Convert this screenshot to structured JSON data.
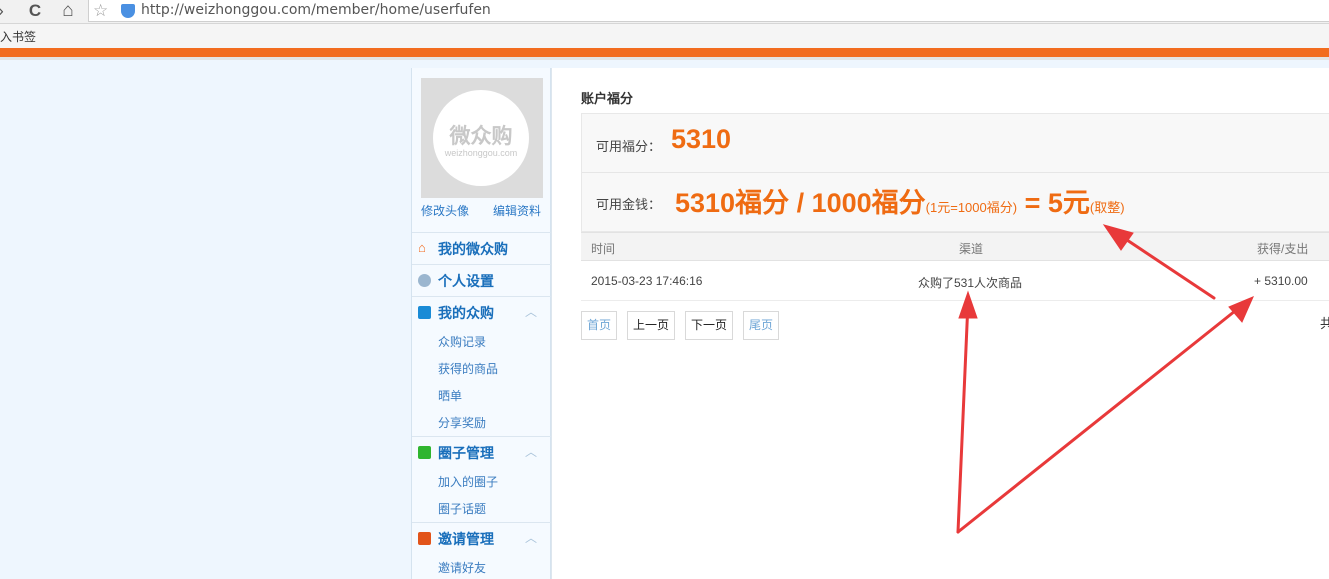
{
  "browser": {
    "back_glyph": "›",
    "reload_glyph": "C",
    "home_glyph": "⌂",
    "star_glyph": "☆",
    "url": "http://weizhonggou.com/member/home/userfufen",
    "bookmarks_text": "入书签"
  },
  "sidebar": {
    "avatar_logo": "微众购",
    "avatar_domain": "weizhonggou.com",
    "change_avatar": "修改头像",
    "edit_profile": "编辑资料",
    "menus": [
      {
        "label": "我的微众购",
        "icon": "home-icon",
        "color": "#f26c1f"
      },
      {
        "label": "个人设置",
        "icon": "gear-icon",
        "color": "#9bb6cf"
      },
      {
        "label": "我的众购",
        "icon": "plane-icon",
        "color": "#1a8bd6",
        "caret": "︿",
        "items": [
          "众购记录",
          "获得的商品",
          "晒单",
          "分享奖励"
        ]
      },
      {
        "label": "圈子管理",
        "icon": "circle-icon",
        "color": "#2fb52f",
        "caret": "︿",
        "items": [
          "加入的圈子",
          "圈子话题"
        ]
      },
      {
        "label": "邀请管理",
        "icon": "invite-icon",
        "color": "#e2541a",
        "caret": "︿",
        "items": [
          "邀请好友"
        ]
      }
    ]
  },
  "main": {
    "title": "账户福分",
    "available_label": "可用福分：",
    "available_value": "5310",
    "money_label": "可用金钱：",
    "formula": {
      "points": "5310福分",
      "sep": " / ",
      "divisor": "1000福分",
      "rate_note": "(1元=1000福分)",
      "equals": " = ",
      "result": "5元",
      "rounding": "(取整)"
    },
    "table": {
      "headers": [
        "时间",
        "渠道",
        "获得/支出"
      ],
      "rows": [
        {
          "time": "2015-03-23 17:46:16",
          "channel": "众购了531人次商品",
          "amount": "+ 5310.00"
        }
      ]
    },
    "pager": {
      "first": "首页",
      "prev": "上一页",
      "next": "下一页",
      "last": "尾页",
      "extra": "共"
    }
  },
  "colors": {
    "accent": "#ef6b12",
    "link": "#1a6fbb",
    "arrow": "#e8393a"
  }
}
